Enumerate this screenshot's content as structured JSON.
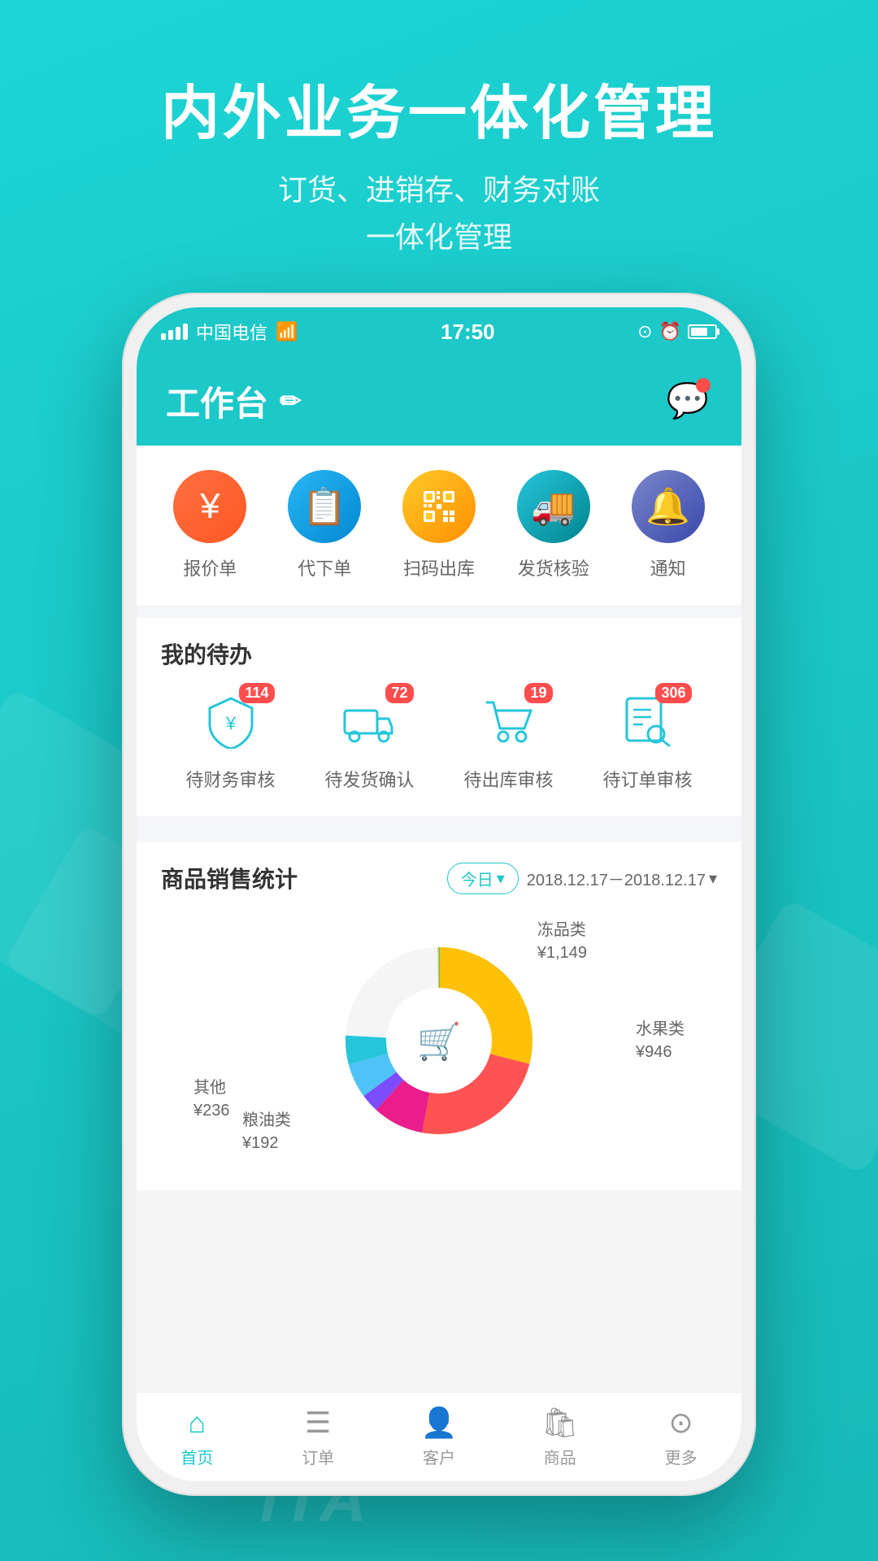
{
  "background": {
    "color": "#1cc8c8"
  },
  "header": {
    "title": "内外业务一体化管理",
    "subtitle_line1": "订货、进销存、财务对账",
    "subtitle_line2": "一体化管理"
  },
  "status_bar": {
    "carrier": "中国电信",
    "time": "17:50"
  },
  "app_header": {
    "title": "工作台",
    "edit_icon": "✏",
    "notification_has_badge": true
  },
  "quick_actions": [
    {
      "label": "报价单",
      "color": "orange",
      "icon": "¥"
    },
    {
      "label": "代下单",
      "color": "blue",
      "icon": "📋"
    },
    {
      "label": "扫码出库",
      "color": "yellow",
      "icon": "▦"
    },
    {
      "label": "发货核验",
      "color": "teal",
      "icon": "🚚"
    },
    {
      "label": "通知",
      "color": "indigo",
      "icon": "🔔"
    }
  ],
  "todo": {
    "section_title": "我的待办",
    "items": [
      {
        "label": "待财务审核",
        "badge": "114",
        "icon": "🛡"
      },
      {
        "label": "待发货确认",
        "badge": "72",
        "icon": "🚚"
      },
      {
        "label": "待出库审核",
        "badge": "19",
        "icon": "🛒"
      },
      {
        "label": "待订单审核",
        "badge": "306",
        "icon": "🔍"
      }
    ]
  },
  "sales_stats": {
    "title": "商品销售统计",
    "period_label": "今日",
    "date_range": "2018.12.17－2018.12.17",
    "chart_labels": [
      {
        "name": "冻品类",
        "value": "¥1,149",
        "position": "top-right"
      },
      {
        "name": "水果类",
        "value": "¥946",
        "position": "right"
      },
      {
        "name": "其他",
        "value": "¥236",
        "position": "bottom-left"
      },
      {
        "name": "粮油类",
        "value": "¥192",
        "position": "bottom-center"
      }
    ]
  },
  "bottom_nav": [
    {
      "label": "首页",
      "active": true,
      "icon": "🏠"
    },
    {
      "label": "订单",
      "active": false,
      "icon": "☰"
    },
    {
      "label": "客户",
      "active": false,
      "icon": "👤"
    },
    {
      "label": "商品",
      "active": false,
      "icon": "🛍"
    },
    {
      "label": "更多",
      "active": false,
      "icon": "⊙"
    }
  ],
  "watermark": "iTA"
}
